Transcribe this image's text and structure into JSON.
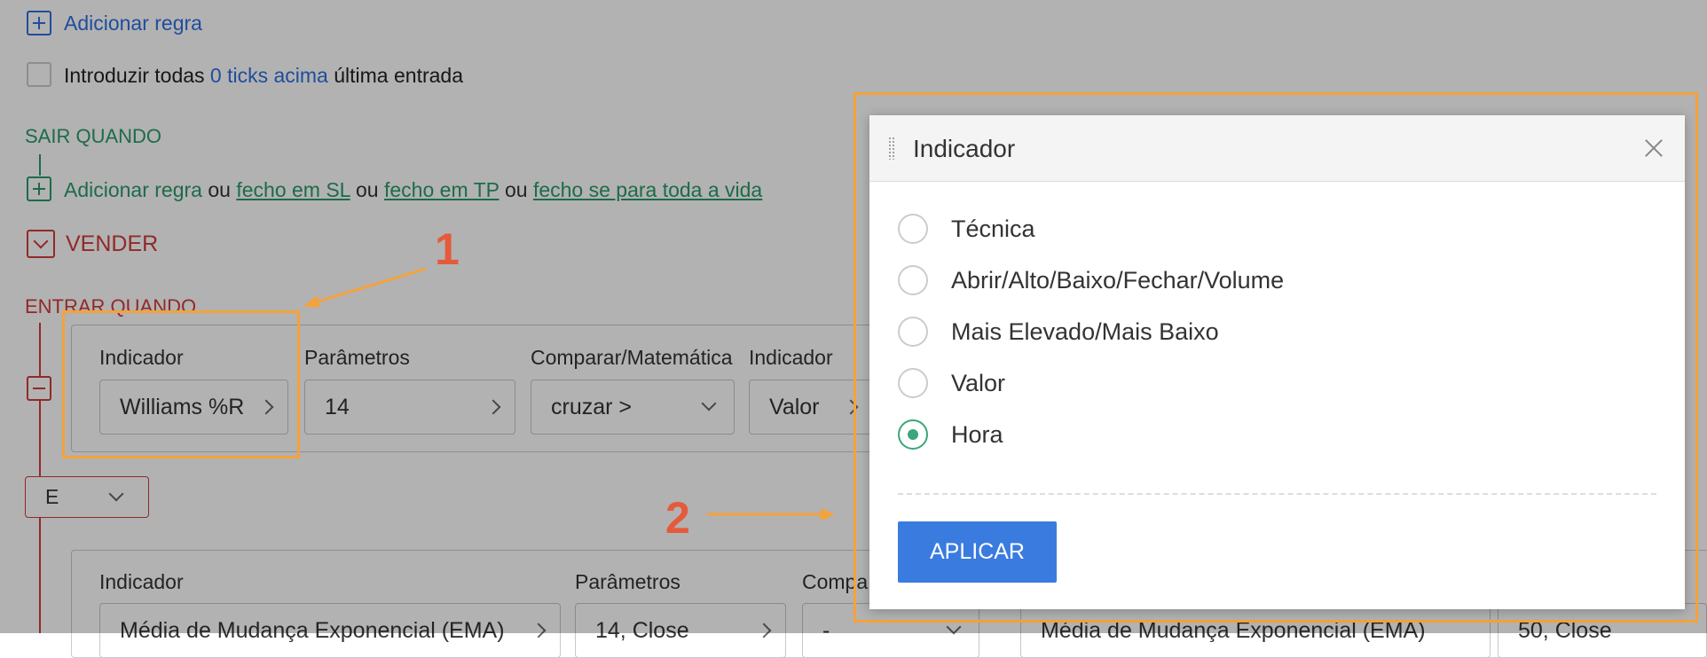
{
  "top": {
    "add_rule_1": "Adicionar regra",
    "entry_prefix": "Introduzir todas",
    "entry_link": "0 ticks acima",
    "entry_suffix": "última entrada"
  },
  "exit": {
    "title": "SAIR QUANDO",
    "add_rule": "Adicionar regra",
    "or1": "ou",
    "close_sl": "fecho em SL",
    "or2": "ou",
    "close_tp": "fecho em TP",
    "or3": "ou",
    "close_life": "fecho se para toda a vida"
  },
  "sell": {
    "label": "VENDER",
    "enter_when": "ENTRAR QUANDO"
  },
  "rule1": {
    "indicator_label": "Indicador",
    "indicator_value": "Williams %R",
    "params_label": "Parâmetros",
    "params_value": "14",
    "compare_label": "Comparar/Matemática",
    "compare_value": "cruzar >",
    "indicator2_label": "Indicador",
    "indicator2_value": "Valor"
  },
  "logic": {
    "value": "E"
  },
  "rule2": {
    "indicator_label": "Indicador",
    "indicator_value": "Média de Mudança Exponencial (EMA)",
    "params_label": "Parâmetros",
    "params_value": "14, Close",
    "compare_label": "Compa",
    "compare_value": "-",
    "indicator2_value": "Média de Mudança Exponencial (EMA)",
    "params2_value": "50, Close"
  },
  "annotations": {
    "n1": "1",
    "n2": "2"
  },
  "modal": {
    "title": "Indicador",
    "options": [
      "Técnica",
      "Abrir/Alto/Baixo/Fechar/Volume",
      "Mais Elevado/Mais Baixo",
      "Valor",
      "Hora"
    ],
    "selected": "Hora",
    "apply": "APLICAR"
  },
  "colors": {
    "accent_blue": "#3a7be0",
    "green": "#2a9a6a",
    "red": "#d23b3b",
    "annotation_orange": "#f5a23a",
    "annotation_number": "#e55a3a"
  }
}
